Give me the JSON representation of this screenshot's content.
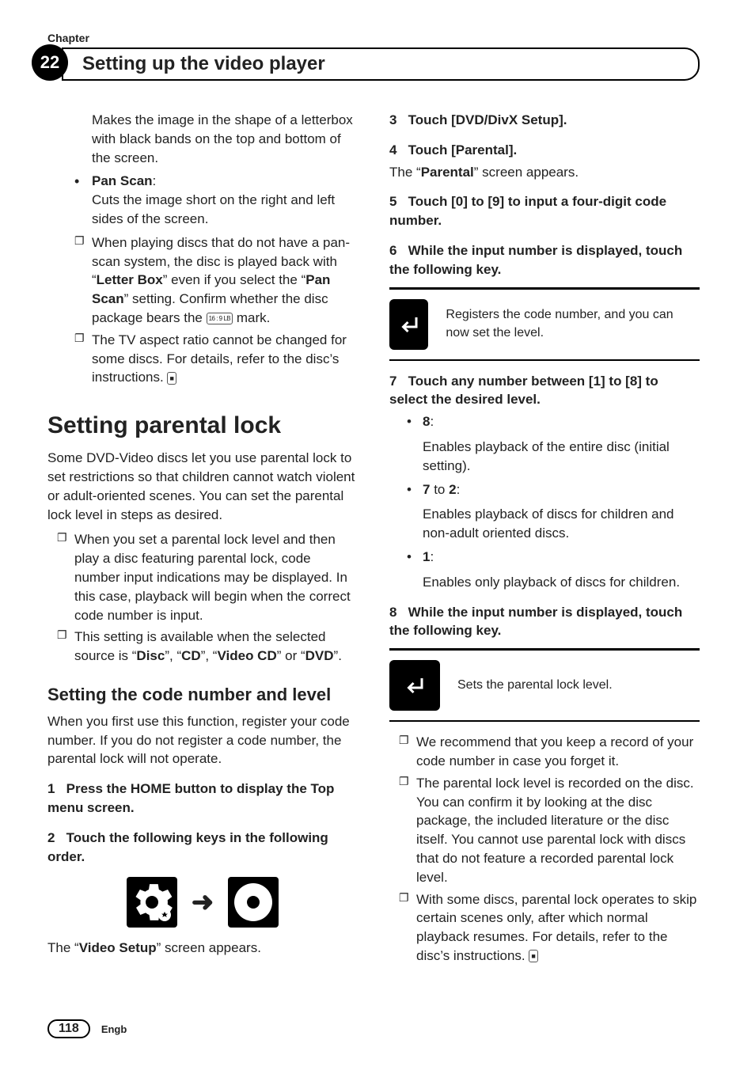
{
  "header": {
    "chapter_label": "Chapter",
    "chapter_number": "22",
    "title": "Setting up the video player"
  },
  "left": {
    "intro_continued": "Makes the image in the shape of a letterbox with black bands on the top and bottom of the screen.",
    "pan_scan_label": "Pan Scan",
    "pan_scan_desc": "Cuts the image short on the right and left sides of the screen.",
    "note1_a": "When playing discs that do not have a pan-scan system, the disc is played back with “",
    "note1_letterbox": "Letter Box",
    "note1_b": "” even if you select the “",
    "note1_panscan": "Pan Scan",
    "note1_c": "” setting. Confirm whether the disc package bears the ",
    "lb_mark_text": "16 : 9  LB",
    "note1_d": " mark.",
    "note2": "The TV aspect ratio cannot be changed for some discs. For details, refer to the disc’s instructions.",
    "end_icon": "■",
    "section_title": "Setting parental lock",
    "section_body": "Some DVD-Video discs let you use parental lock to set restrictions so that children cannot watch violent or adult-oriented scenes. You can set the parental lock level in steps as desired.",
    "section_note1": "When you set a parental lock level and then play a disc featuring parental lock, code number input indications may be displayed. In this case, playback will begin when the correct code number is input.",
    "section_note2_a": "This setting is available when the selected source is “",
    "section_note2_disc": "Disc",
    "section_note2_b": "”, “",
    "section_note2_cd": "CD",
    "section_note2_c": "”, “",
    "section_note2_vcd": "Video CD",
    "section_note2_d": "” or “",
    "section_note2_dvd": "DVD",
    "section_note2_e": "”.",
    "sub_title": "Setting the code number and level",
    "sub_body": "When you first use this function, register your code number. If you do not register a code number, the parental lock will not operate.",
    "step1": "Press the HOME button to display the Top menu screen.",
    "step2": "Touch the following keys in the following order.",
    "video_setup_a": "The “",
    "video_setup_bold": "Video Setup",
    "video_setup_b": "” screen appears."
  },
  "right": {
    "step3": "Touch [DVD/DivX Setup].",
    "step4": "Touch [Parental].",
    "step4_after_a": "The “",
    "step4_after_bold": "Parental",
    "step4_after_b": "” screen appears.",
    "step5": "Touch [0] to [9] to input a four-digit code number.",
    "step6": "While the input number is displayed, touch the following key.",
    "step6_key_desc": "Registers the code number, and you can now set the level.",
    "step7": "Touch any number between [1] to [8] to select the desired level.",
    "lvl8_label": "8",
    "lvl8_desc": "Enables playback of the entire disc (initial setting).",
    "lvl72_label_a": "7",
    "lvl72_to": " to ",
    "lvl72_label_b": "2",
    "lvl72_desc": "Enables playback of discs for children and non-adult oriented discs.",
    "lvl1_label": "1",
    "lvl1_desc": "Enables only playback of discs for children.",
    "step8": "While the input number is displayed, touch the following key.",
    "step8_key_desc": "Sets the parental lock level.",
    "tail_note1": "We recommend that you keep a record of your code number in case you forget it.",
    "tail_note2": "The parental lock level is recorded on the disc. You can confirm it by looking at the disc package, the included literature or the disc itself. You cannot use parental lock with discs that do not feature a recorded parental lock level.",
    "tail_note3": "With some discs, parental lock operates to skip certain scenes only, after which normal playback resumes. For details, refer to the disc’s instructions.",
    "end_icon": "■"
  },
  "footer": {
    "page": "118",
    "lang": "Engb"
  },
  "steps": {
    "n1": "1",
    "n2": "2",
    "n3": "3",
    "n4": "4",
    "n5": "5",
    "n6": "6",
    "n7": "7",
    "n8": "8"
  }
}
